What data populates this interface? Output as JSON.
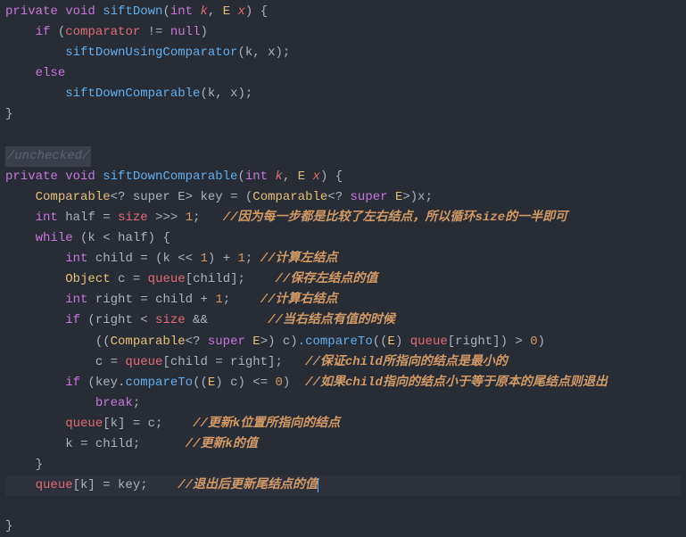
{
  "code": {
    "l1": {
      "kw_private": "private",
      "kw_void": "void",
      "fn": "siftDown",
      "p_int": "int",
      "p_k": "k",
      "p_E": "E",
      "p_x": "x"
    },
    "l2": {
      "kw_if": "if",
      "var": "comparator",
      "op": "!=",
      "null": "null"
    },
    "l3": {
      "fn": "siftDownUsingComparator",
      "a1": "k",
      "a2": "x"
    },
    "l4": {
      "kw_else": "else"
    },
    "l5": {
      "fn": "siftDownComparable",
      "a1": "k",
      "a2": "x"
    },
    "l6": {
      "close": "}"
    },
    "blank": "",
    "l8": {
      "comment": "/unchecked/"
    },
    "l9": {
      "kw_private": "private",
      "kw_void": "void",
      "fn": "siftDownComparable",
      "p_int": "int",
      "p_k": "k",
      "p_E": "E",
      "p_x": "x"
    },
    "l10": {
      "type": "Comparable",
      "generic": "<? super E>",
      "var": "key",
      "eq": "=",
      "cast": "(Comparable<? super E>)",
      "x": "x"
    },
    "l11": {
      "kw_int": "int",
      "var": "half",
      "eq": "=",
      "size": "size",
      "op": ">>>",
      "num": "1",
      "comment": "//因为每一步都是比较了左右结点，所以循环size的一半即可"
    },
    "l12": {
      "kw_while": "while",
      "cond": "(k < half) {"
    },
    "l13": {
      "kw_int": "int",
      "var": "child",
      "eq": "=",
      "expr": "(k << ",
      "num1": "1",
      "op": ") + ",
      "num2": "1",
      "comment": "//计算左结点"
    },
    "l14": {
      "type": "Object",
      "var": "c",
      "eq": "=",
      "queue": "queue",
      "idx": "[child]",
      "comment": "//保存左结点的值"
    },
    "l15": {
      "kw_int": "int",
      "var": "right",
      "eq": "=",
      "child": "child",
      "op": "+ ",
      "num": "1",
      "comment": "//计算右结点"
    },
    "l16": {
      "kw_if": "if",
      "cond": "(right < size &&",
      "comment": "//当右结点有值的时候"
    },
    "l17": {
      "cast": "((Comparable<? super E>) c)",
      "fn": ".compareTo",
      "arg": "((E) queue[right]) > ",
      "num": "0",
      "close": ")"
    },
    "l18": {
      "lhs": "c = queue[child = right];",
      "comment": "//保证child所指向的结点是最小的"
    },
    "l19": {
      "kw_if": "if",
      "expr": "(key.",
      "fn": "compareTo",
      "arg": "((E) c) <= ",
      "num": "0",
      "close": ")",
      "comment": "//如果child指向的结点小于等于原本的尾结点则退出"
    },
    "l20": {
      "kw_break": "break"
    },
    "l21": {
      "stmt": "queue[k] = c;",
      "comment": "//更新k位置所指向的结点"
    },
    "l22": {
      "stmt": "k = child;",
      "comment": "//更新k的值"
    },
    "l23": {
      "close": "}"
    },
    "l24": {
      "stmt": "queue[k] = key;",
      "comment": "//退出后更新尾结点的值"
    },
    "l25": {
      "close": "}"
    }
  }
}
